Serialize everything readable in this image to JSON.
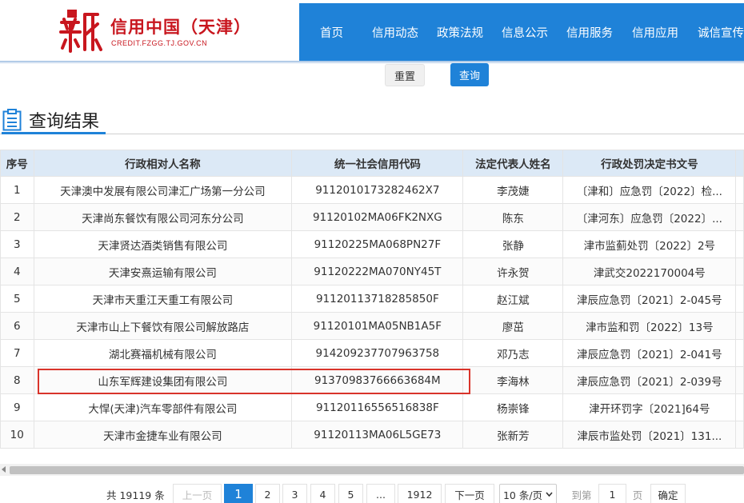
{
  "header": {
    "logo_title": "信用中国（天津）",
    "logo_sub": "CREDIT.FZGG.TJ.GOV.CN",
    "nav": [
      "首页",
      "信用动态",
      "政策法规",
      "信息公示",
      "信用服务",
      "信用应用",
      "诚信宣传"
    ]
  },
  "actions": {
    "reset_label": "重置",
    "query_label": "查询"
  },
  "section": {
    "title": "查询结果"
  },
  "table": {
    "columns": [
      "序号",
      "行政相对人名称",
      "统一社会信用代码",
      "法定代表人姓名",
      "行政处罚决定书文号"
    ],
    "rows": [
      [
        "1",
        "天津澳中发展有限公司津汇广场第一分公司",
        "9112010173282462X7",
        "李茂婕",
        "〔津和〕应急罚〔2022〕检..."
      ],
      [
        "2",
        "天津尚东餐饮有限公司河东分公司",
        "91120102MA06FK2NXG",
        "陈东",
        "〔津河东〕应急罚〔2022〕..."
      ],
      [
        "3",
        "天津贤达酒类销售有限公司",
        "91120225MA068PN27F",
        "张静",
        "津市监蓟处罚〔2022〕2号"
      ],
      [
        "4",
        "天津安熹运输有限公司",
        "91120222MA070NY45T",
        "许永贺",
        "津武交2022170004号"
      ],
      [
        "5",
        "天津市天重江天重工有限公司",
        "91120113718285850F",
        "赵江斌",
        "津辰应急罚〔2021〕2-045号"
      ],
      [
        "6",
        "天津市山上下餐饮有限公司解放路店",
        "91120101MA05NB1A5F",
        "廖茁",
        "津市监和罚〔2022〕13号"
      ],
      [
        "7",
        "湖北赛福机械有限公司",
        "914209237707963758",
        "邓乃志",
        "津辰应急罚〔2021〕2-041号"
      ],
      [
        "8",
        "山东军辉建设集团有限公司",
        "91370983766663684M",
        "李海林",
        "津辰应急罚〔2021〕2-039号"
      ],
      [
        "9",
        "大悍(天津)汽车零部件有限公司",
        "91120116556516838F",
        "杨崇锋",
        "津开环罚字〔2021]64号"
      ],
      [
        "10",
        "天津市金捷车业有限公司",
        "91120113MA06L5GE73",
        "张新芳",
        "津辰市监处罚〔2021〕131..."
      ]
    ]
  },
  "pagination": {
    "total_text": "共 19119 条",
    "prev": "上一页",
    "pages": [
      "1",
      "2",
      "3",
      "4",
      "5",
      "...",
      "1912"
    ],
    "current": "1",
    "next": "下一页",
    "page_size": "10 条/页",
    "goto_label": "到第",
    "goto_value": "1",
    "page_unit": "页",
    "confirm": "确定"
  },
  "colors": {
    "brand_blue": "#1f82d8",
    "logo_red": "#c8161e",
    "highlight_red": "#d9342b",
    "header_row_bg": "#dce9f6"
  }
}
